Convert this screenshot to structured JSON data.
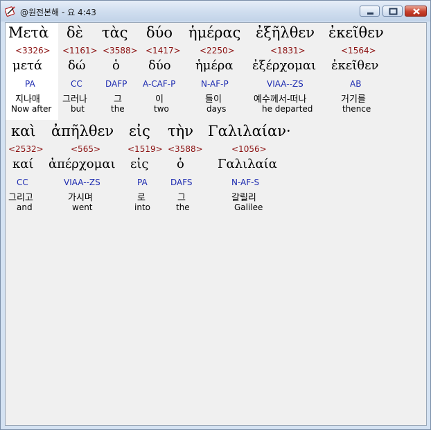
{
  "window": {
    "title": "@원전본해 - 요 4:43"
  },
  "verse": {
    "line1": [
      {
        "greek": "Μετὰ",
        "strong": "<3326>",
        "lemma": "μετά",
        "morph": "PA",
        "korean": "지나매",
        "english": "Now after"
      },
      {
        "greek": "δὲ",
        "strong": "<1161>",
        "lemma": "δώ",
        "morph": "CC",
        "korean": "그러나",
        "english": "but"
      },
      {
        "greek": "τὰς",
        "strong": "<3588>",
        "lemma": "ὁ",
        "morph": "DAFP",
        "korean": "그",
        "english": "the"
      },
      {
        "greek": "δύο",
        "strong": "<1417>",
        "lemma": "δύο",
        "morph": "A-CAF-P",
        "korean": "이",
        "english": "two"
      },
      {
        "greek": "ἡμέρας",
        "strong": "<2250>",
        "lemma": "ἡμέρα",
        "morph": "N-AF-P",
        "korean": "틀이",
        "english": "days"
      },
      {
        "greek": "ἐξῆλθεν",
        "strong": "<1831>",
        "lemma": "ἐξέρχομαι",
        "morph": "VIAA--ZS",
        "korean": "예수께서-떠나",
        "english": "he departed"
      },
      {
        "greek": "ἐκεῖθεν",
        "strong": "<1564>",
        "lemma": "ἐκεῖθεν",
        "morph": "AB",
        "korean": "거기를",
        "english": "thence"
      }
    ],
    "line2": [
      {
        "greek": "καὶ",
        "strong": "<2532>",
        "lemma": "καί",
        "morph": "CC",
        "korean": "그리고",
        "english": "and"
      },
      {
        "greek": "ἀπῆλθεν",
        "strong": "<565>",
        "lemma": "ἀπέρχομαι",
        "morph": "VIAA--ZS",
        "korean": "가시며",
        "english": "went"
      },
      {
        "greek": "εἰς",
        "strong": "<1519>",
        "lemma": "εἰς",
        "morph": "PA",
        "korean": "로",
        "english": "into"
      },
      {
        "greek": "τὴν",
        "strong": "<3588>",
        "lemma": "ὁ",
        "morph": "DAFS",
        "korean": "그",
        "english": "the"
      },
      {
        "greek": "Γαλιλαίαν·",
        "strong": "<1056>",
        "lemma": "Γαλιλαία",
        "morph": "N-AF-S",
        "korean": "갈릴리",
        "english": "Galilee"
      }
    ]
  },
  "icons": {
    "app": "book-pen-icon",
    "minimize": "minimize-icon",
    "maximize": "maximize-icon",
    "close": "close-icon"
  },
  "colors": {
    "strong": "#8b1010",
    "morph": "#1c2ab0",
    "text": "#000000"
  }
}
